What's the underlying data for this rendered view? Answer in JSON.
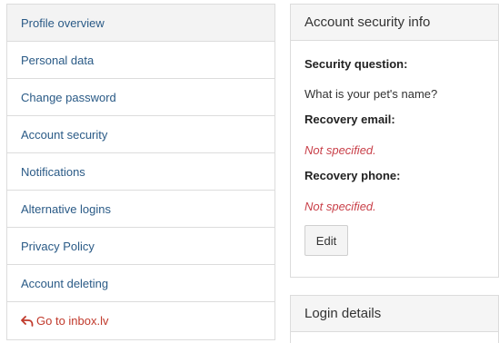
{
  "nav": {
    "items": [
      {
        "label": "Profile overview"
      },
      {
        "label": "Personal data"
      },
      {
        "label": "Change password"
      },
      {
        "label": "Account security"
      },
      {
        "label": "Notifications"
      },
      {
        "label": "Alternative logins"
      },
      {
        "label": "Privacy Policy"
      },
      {
        "label": "Account deleting"
      }
    ],
    "back_link": {
      "label": "Go to inbox.lv",
      "icon": "back-arrow-icon"
    }
  },
  "security_panel": {
    "title": "Account security info",
    "question_label": "Security question:",
    "question_value": "What is your pet's name?",
    "email_label": "Recovery email:",
    "email_value": "Not specified.",
    "phone_label": "Recovery phone:",
    "phone_value": "Not specified.",
    "edit_label": "Edit"
  },
  "login_panel": {
    "title": "Login details"
  },
  "colors": {
    "link": "#2a5a86",
    "back_link": "#c0392b",
    "missing_value": "#c9414a",
    "border": "#dcdcdc",
    "header_bg": "#f5f5f5"
  }
}
